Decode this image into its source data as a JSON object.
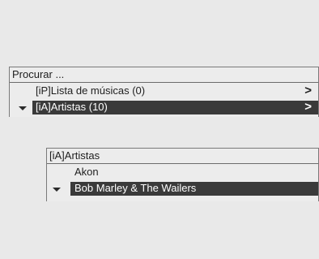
{
  "search_panel": {
    "title": "Procurar ...",
    "items": [
      {
        "label": "[iP]Lista de músicas (0)",
        "chevron": ">",
        "selected": false
      },
      {
        "label": "[iA]Artistas (10)",
        "chevron": ">",
        "selected": true
      }
    ]
  },
  "artist_panel": {
    "title": "[iA]Artistas",
    "items": [
      {
        "label": "Akon",
        "selected": false
      },
      {
        "label": "Bob Marley & The Wailers",
        "selected": true
      }
    ]
  },
  "colors": {
    "background": "#e9e9e9",
    "selection": "#3a3a3a",
    "text": "#1e1e1e"
  },
  "icons": {
    "scroll_indicator": "down-arrow-icon",
    "submenu": "chevron-right-icon"
  }
}
